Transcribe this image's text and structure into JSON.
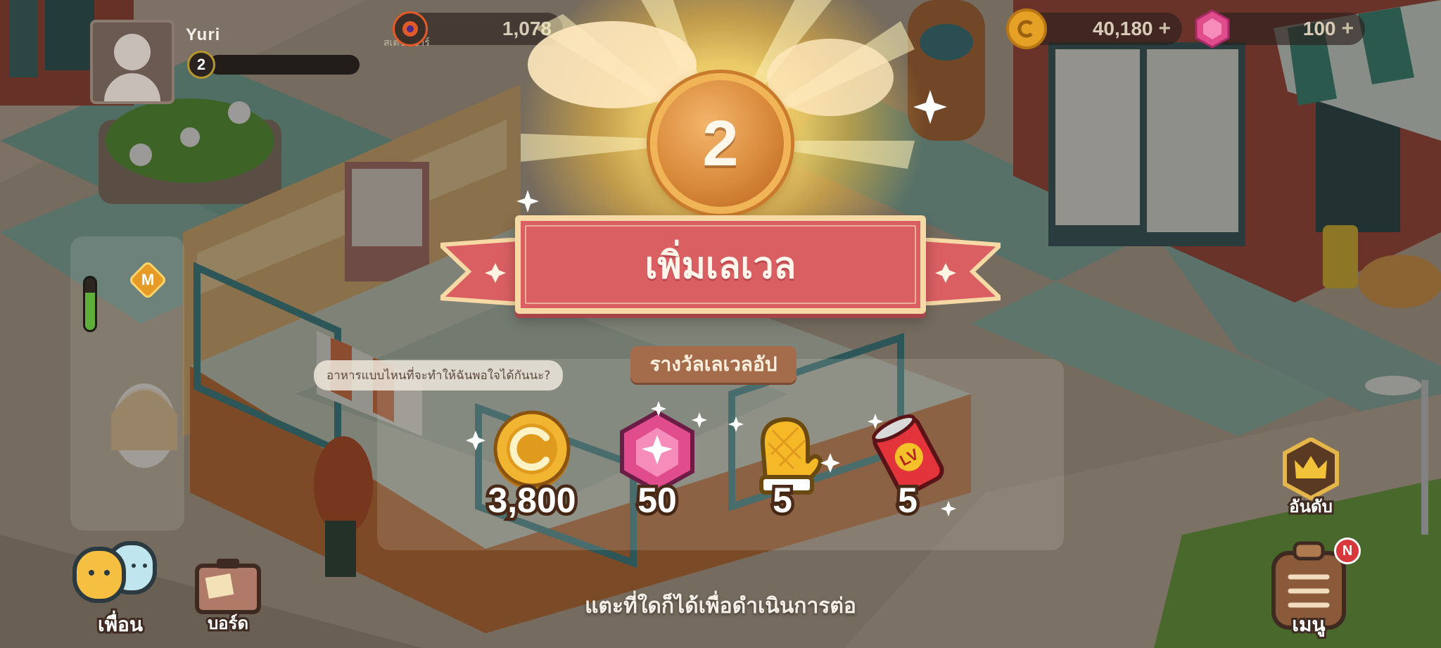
{
  "player": {
    "name": "Yuri",
    "level": "2",
    "xp_fraction": 0.0
  },
  "station": {
    "label": "สเตชั่นบาร์",
    "value": "1,078"
  },
  "resources": {
    "coins": {
      "value": "40,180",
      "icon": "coin-icon"
    },
    "gems": {
      "value": "100",
      "icon": "gem-icon"
    },
    "add_glyph": "+"
  },
  "levelup": {
    "new_level": "2",
    "banner_text": "เพิ่มเลเวล",
    "rewards_title": "รางวัลเลเวลอัป",
    "rewards": [
      {
        "icon": "coin-icon",
        "value": "3,800"
      },
      {
        "icon": "gem-icon",
        "value": "50"
      },
      {
        "icon": "oven-mitt-icon",
        "value": "5"
      },
      {
        "icon": "lv-energy-can-icon",
        "value": "5"
      }
    ],
    "continue_hint": "แตะที่ใดก็ได้เพื่อดำเนินการต่อ"
  },
  "speech_bubble": "อาหารแบบไหนที่จะทำให้ฉันพอใจได้กันนะ?",
  "side": {
    "badge_letter": "M",
    "energy_fraction": 0.72
  },
  "bottom_nav": {
    "friends_label": "เพื่อน",
    "board_label": "บอร์ด",
    "ranking_label": "อันดับ",
    "menu_label": "เมนู",
    "menu_badge": "N"
  },
  "colors": {
    "ribbon": "#d95f63",
    "ribbon_border": "#f6d9a4",
    "medal": "#d98a3a",
    "reward_title_bg": "#a56c4c",
    "coin": "#e5a126",
    "gem": "#e04c8c"
  }
}
